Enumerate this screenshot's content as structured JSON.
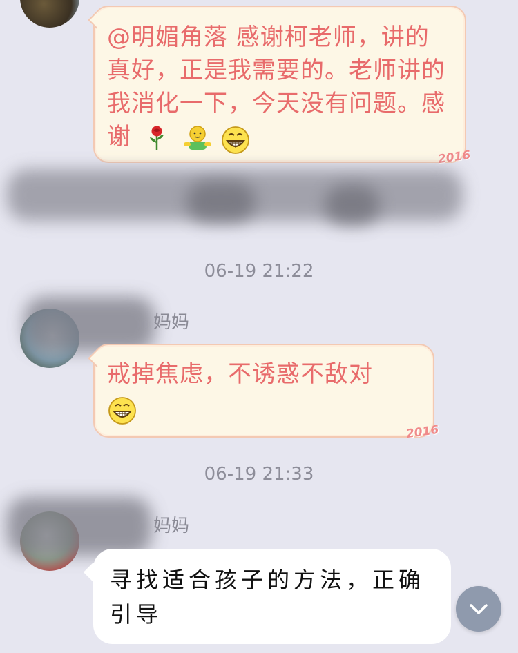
{
  "messages": [
    {
      "text": "@明媚角落 感谢柯老师，讲的真好，正是我需要的。老师讲的我消化一下，今天没有问题。感谢",
      "decoration": "2016",
      "emojis": [
        "rose-icon",
        "hug-icon",
        "grin-icon"
      ]
    },
    {
      "timestamp": "06-19 21:22",
      "sender": "妈妈",
      "text": "戒掉焦虑，不诱惑不敌对",
      "decoration": "2016",
      "emojis": [
        "grin-icon"
      ]
    },
    {
      "timestamp": "06-19 21:33",
      "sender": "妈妈",
      "text": "寻找适合孩子的方法，正确引导"
    }
  ],
  "colors": {
    "background": "#e6e6f0",
    "fancy_bubble_bg": "#fdf7e6",
    "fancy_bubble_border": "#f3c9b3",
    "fancy_text": "#e86b6b",
    "timestamp": "#8d8d99",
    "scroll_button": "#8f9aad"
  },
  "scroll_button_icon": "chevron-down-icon"
}
